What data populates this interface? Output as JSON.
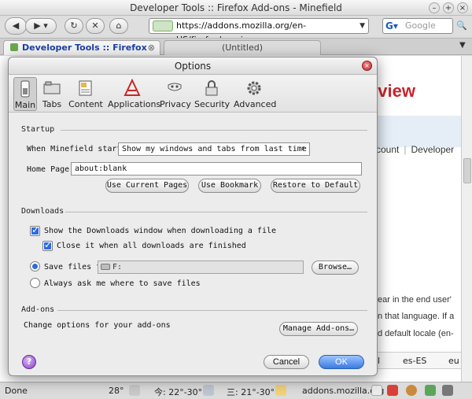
{
  "window": {
    "title": "Developer Tools :: Firefox Add-ons - Minefield"
  },
  "navbar": {
    "url": "https://addons.mozilla.org/en-US/firefox/preview",
    "search_placeholder": "Google"
  },
  "tabs": [
    {
      "label": "Developer Tools :: Firefox Ad...",
      "active": true
    },
    {
      "label": "(Untitled)",
      "active": false
    }
  ],
  "page": {
    "hero": "eview",
    "account_link": "ccount",
    "developer_link": "Developer",
    "body_lines": [
      "ear in the end user'",
      "n that language. If a",
      "d default locale (en-"
    ],
    "table_cells": [
      "l",
      "es-ES",
      "eu"
    ]
  },
  "status": {
    "done": "Done",
    "temp_now": "28°",
    "forecast1": "今: 22°-30°",
    "forecast2": "三: 21°-30°",
    "domain": "addons.mozilla.org"
  },
  "dialog": {
    "title": "Options",
    "panes": [
      {
        "label": "Main",
        "icon": "main-switch-icon",
        "selected": true
      },
      {
        "label": "Tabs",
        "icon": "tabs-icon",
        "selected": false
      },
      {
        "label": "Content",
        "icon": "content-icon",
        "selected": false
      },
      {
        "label": "Applications",
        "icon": "applications-icon",
        "selected": false
      },
      {
        "label": "Privacy",
        "icon": "privacy-mask-icon",
        "selected": false
      },
      {
        "label": "Security",
        "icon": "security-lock-icon",
        "selected": false
      },
      {
        "label": "Advanced",
        "icon": "advanced-gear-icon",
        "selected": false
      }
    ],
    "startup": {
      "section": "Startup",
      "when_label": "When Minefield starts:",
      "when_value": "Show my windows and tabs from last time",
      "home_label": "Home Page:",
      "home_value": "about:blank",
      "use_current": "Use Current Pages",
      "use_bookmark": "Use Bookmark",
      "restore_default": "Restore to Default"
    },
    "downloads": {
      "section": "Downloads",
      "show_window": "Show the Downloads window when downloading a file",
      "show_window_checked": true,
      "close_when_done": "Close it when all downloads are finished",
      "close_when_done_checked": true,
      "save_files_to": "Save files to",
      "save_path": "F:",
      "browse": "Browse…",
      "always_ask": "Always ask me where to save files",
      "selected_option": "save_files_to"
    },
    "addons": {
      "section": "Add-ons",
      "desc": "Change options for your add-ons",
      "manage": "Manage Add-ons…"
    },
    "cancel": "Cancel",
    "ok": "OK"
  }
}
